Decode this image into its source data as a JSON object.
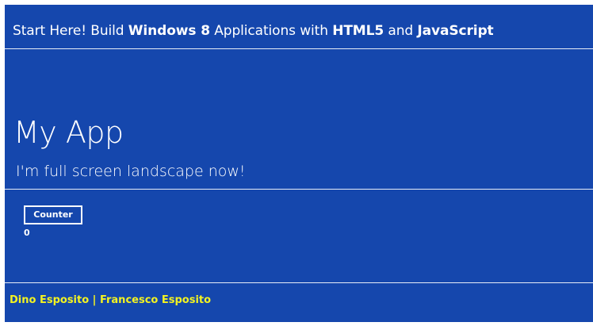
{
  "header": {
    "part1": "Start Here! Build ",
    "bold1": "Windows 8",
    "part2": " Applications with ",
    "bold2": "HTML5",
    "part3": " and ",
    "bold3": "JavaScript"
  },
  "main": {
    "title": "My App",
    "subtitle": "I'm full screen landscape now!",
    "counter_button_label": "Counter",
    "counter_value": "0"
  },
  "footer": {
    "authors": "Dino Esposito | Francesco Esposito"
  },
  "colors": {
    "background": "#1547ad",
    "text": "#ffffff",
    "footer_text": "#f3f321"
  }
}
